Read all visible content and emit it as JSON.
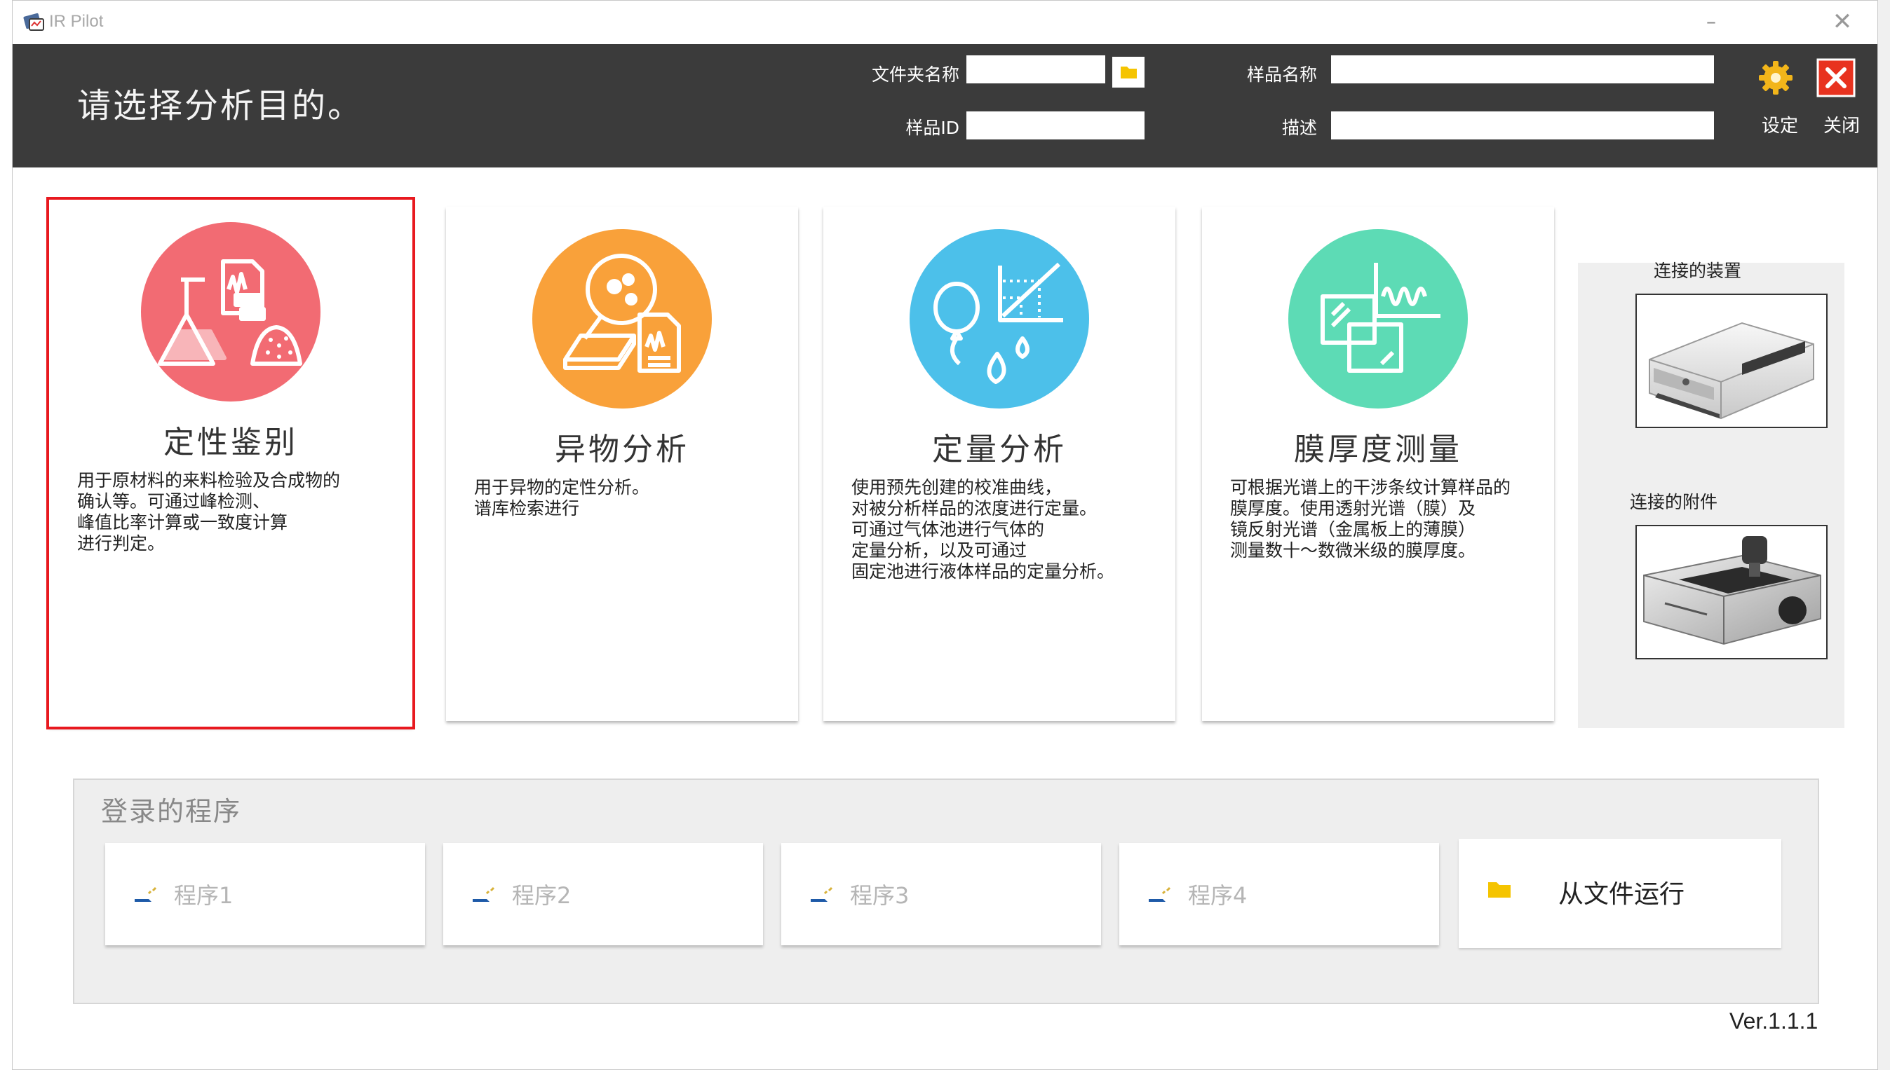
{
  "window": {
    "title": "IR Pilot"
  },
  "header": {
    "prompt": "请选择分析目的。",
    "folder_name_label": "文件夹名称",
    "folder_name_value": "",
    "sample_name_label": "样品名称",
    "sample_name_value": "",
    "sample_id_label": "样品ID",
    "sample_id_value": "",
    "description_label": "描述",
    "description_value": "",
    "settings_label": "设定",
    "close_label": "关闭"
  },
  "cards": [
    {
      "title": "定性鉴别",
      "desc": "用于原材料的来料检验及合成物的\n确认等。可通过峰检测、\n峰值比率计算或一致度计算\n进行判定。",
      "selected": true,
      "icon": "flask-pass-fail-icon",
      "color": "#f26b73"
    },
    {
      "title": "异物分析",
      "desc": "用于异物的定性分析。\n谱库检索进行",
      "selected": false,
      "icon": "foreign-matter-icon",
      "color": "#f9a13a"
    },
    {
      "title": "定量分析",
      "desc": "使用预先创建的校准曲线，\n对被分析样品的浓度进行定量。\n可通过气体池进行气体的\n定量分析，以及可通过\n固定池进行液体样品的定量分析。",
      "selected": false,
      "icon": "calibration-curve-icon",
      "color": "#4cc0ea"
    },
    {
      "title": "膜厚度测量",
      "desc": "可根据光谱上的干涉条纹计算样品的\n膜厚度。使用透射光谱（膜）及\n镜反射光谱（金属板上的薄膜）\n测量数十～数微米级的膜厚度。",
      "selected": false,
      "icon": "film-thickness-icon",
      "color": "#5ddbb5"
    }
  ],
  "side": {
    "device_label": "连接的装置",
    "accessory_label": "连接的附件"
  },
  "programs": {
    "title": "登录的程序",
    "items": [
      "程序1",
      "程序2",
      "程序3",
      "程序4"
    ],
    "run_from_file": "从文件运行"
  },
  "version": "Ver.1.1.1"
}
